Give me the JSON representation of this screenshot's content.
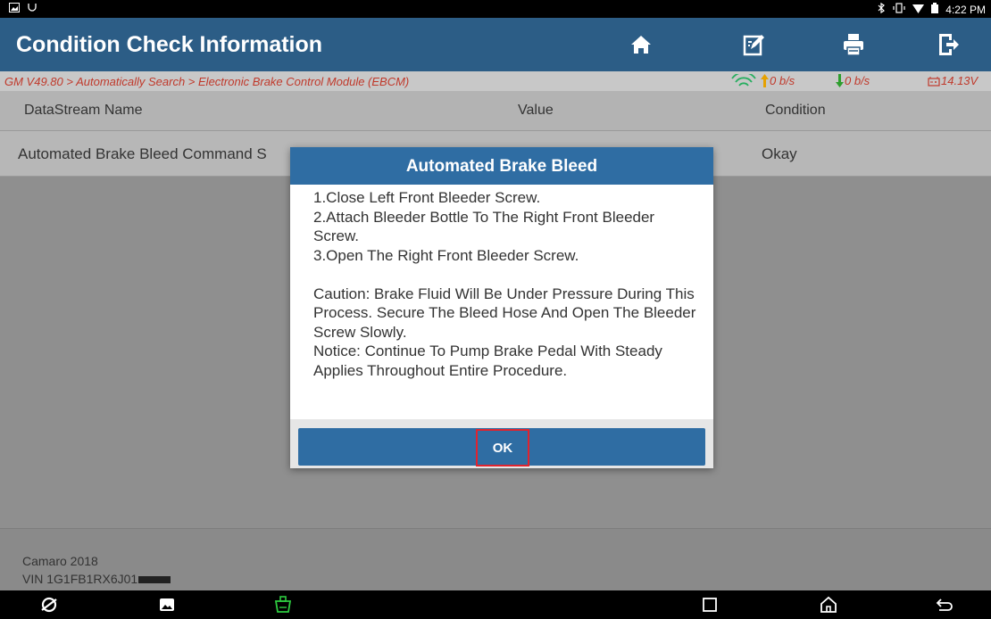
{
  "statusbar": {
    "time": "4:22 PM"
  },
  "header": {
    "title": "Condition Check Information",
    "buttons": [
      "home-icon",
      "edit-report-icon",
      "print-icon",
      "exit-icon"
    ],
    "color": "#2c5d86"
  },
  "breadcrumb": {
    "text": "GM V49.80 > Automatically Search > Electronic Brake Control Module (EBCM)",
    "upload": "0 b/s",
    "download": "0 b/s",
    "voltage": "14.13V"
  },
  "table": {
    "columns": [
      "DataStream Name",
      "Value",
      "Condition"
    ],
    "rows": [
      {
        "name": "Automated Brake Bleed Command S",
        "value": "",
        "condition": "Okay"
      }
    ]
  },
  "footer": {
    "model": "Camaro 2018",
    "vin": "VIN 1G1FB1RX6J01"
  },
  "dialog": {
    "title": "Automated Brake Bleed",
    "steps": "1.Close Left Front Bleeder Screw.\n2.Attach Bleeder Bottle To The Right Front Bleeder Screw.\n3.Open The Right Front Bleeder Screw.",
    "caution": "Caution: Brake Fluid Will Be Under Pressure During This Process. Secure The Bleed Hose And Open The Bleeder Screw Slowly.",
    "notice": "Notice: Continue To Pump Brake Pedal With Steady Applies Throughout Entire Procedure.",
    "ok_label": "OK",
    "accent": "#2f6da3",
    "highlight": "#e0232e"
  },
  "navbar": {
    "icons": [
      "browser-icon",
      "gallery-icon",
      "vci-icon",
      "recents-icon",
      "home-icon",
      "back-icon"
    ]
  }
}
